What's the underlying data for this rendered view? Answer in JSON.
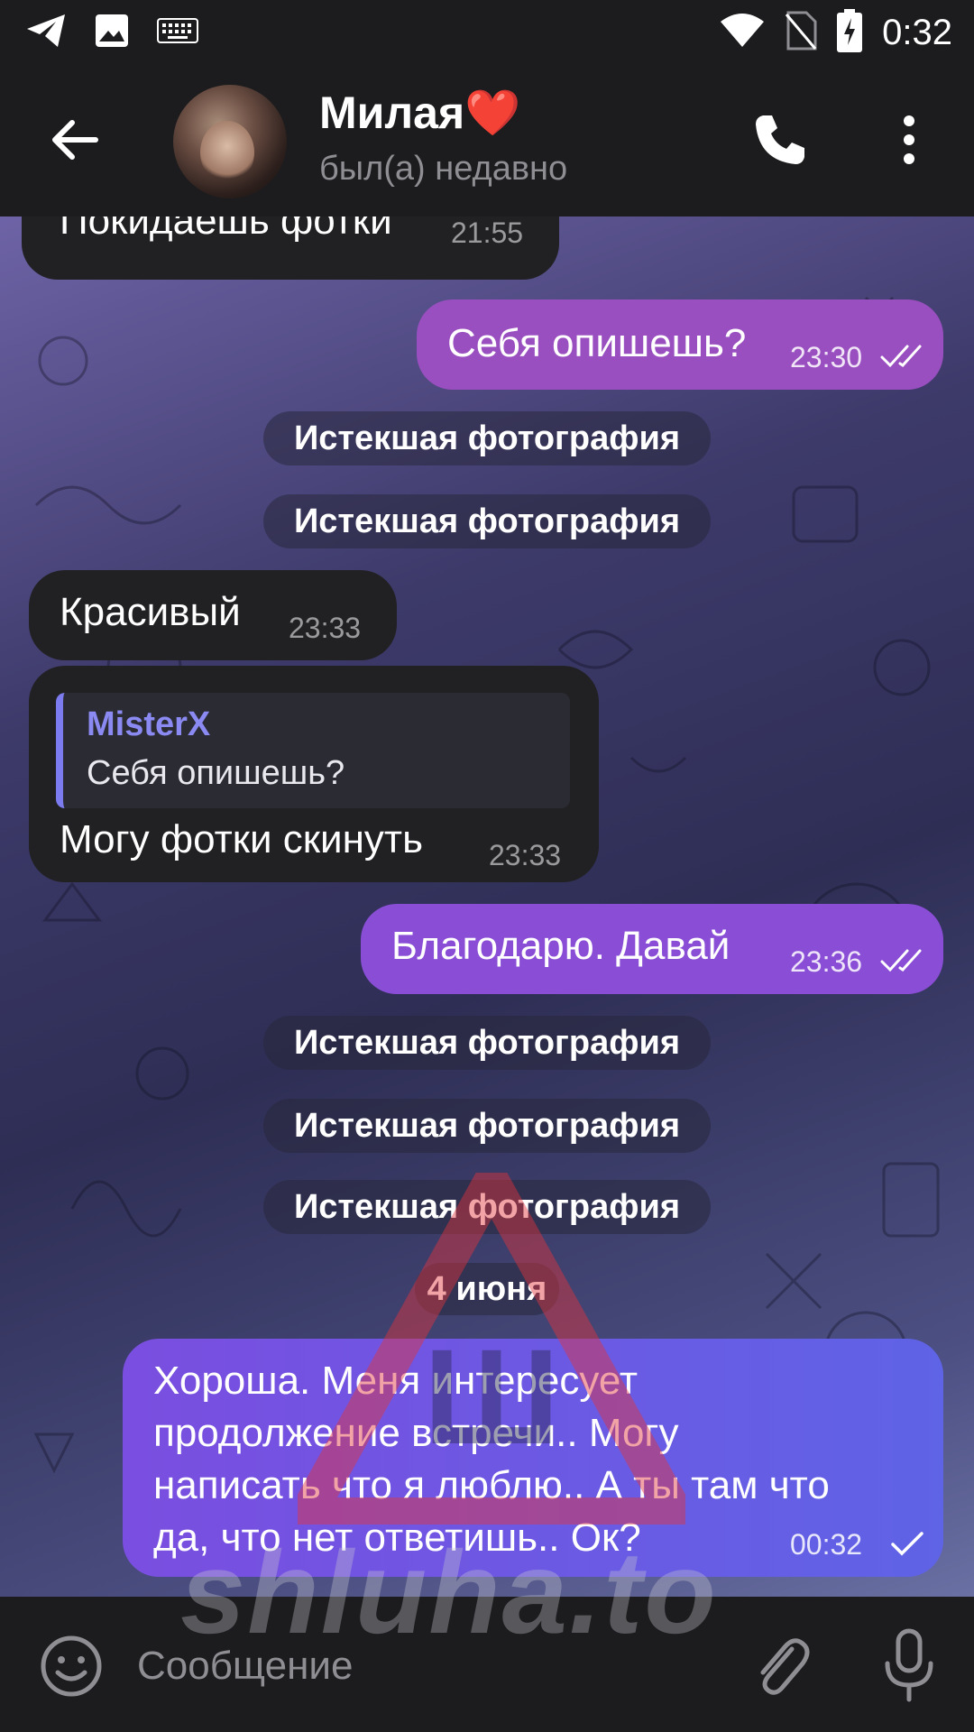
{
  "status_bar": {
    "time": "0:32",
    "icons": [
      "telegram-icon",
      "image-icon",
      "keyboard-icon",
      "wifi-icon",
      "no-sim-icon",
      "battery-charging-icon"
    ]
  },
  "header": {
    "name": "Милая",
    "name_emoji": "❤️",
    "status": "был(а) недавно",
    "icons": [
      "back-arrow-icon",
      "phone-icon",
      "more-vertical-icon"
    ]
  },
  "messages": [
    {
      "dir": "in",
      "text": "Покидаешь фотки",
      "time": "21:55"
    },
    {
      "dir": "out",
      "text": "Себя опишешь?",
      "time": "23:30",
      "status": "read"
    },
    {
      "dir": "service",
      "text": "Истекшая фотография"
    },
    {
      "dir": "service",
      "text": "Истекшая фотография"
    },
    {
      "dir": "in",
      "text": "Красивый",
      "time": "23:33"
    },
    {
      "dir": "in",
      "reply_name": "MisterX",
      "reply_text": "Себя опишешь?",
      "text": "Могу фотки скинуть",
      "time": "23:33"
    },
    {
      "dir": "out",
      "text": "Благодарю. Давай",
      "time": "23:36",
      "status": "read"
    },
    {
      "dir": "service",
      "text": "Истекшая фотография"
    },
    {
      "dir": "service",
      "text": "Истекшая фотография"
    },
    {
      "dir": "service",
      "text": "Истекшая фотография"
    },
    {
      "dir": "date",
      "text": "4 июня"
    },
    {
      "dir": "out",
      "lines": [
        "Хороша. Меня интересует",
        "продолжение встречи.. Могу",
        "написать что я люблю.. А ты там что",
        "да, что нет ответишь.. Ок?"
      ],
      "time": "00:32",
      "status": "sent"
    }
  ],
  "input": {
    "placeholder": "Сообщение",
    "icons": [
      "emoji-icon",
      "attach-icon",
      "microphone-icon"
    ]
  },
  "watermark": {
    "letter": "Ш",
    "text": "shluha.to"
  },
  "colors": {
    "outgoing": "#9a4fc0",
    "incoming": "#212124",
    "reply_accent": "#8a8af2",
    "header_bg": "#1c1c1e"
  }
}
